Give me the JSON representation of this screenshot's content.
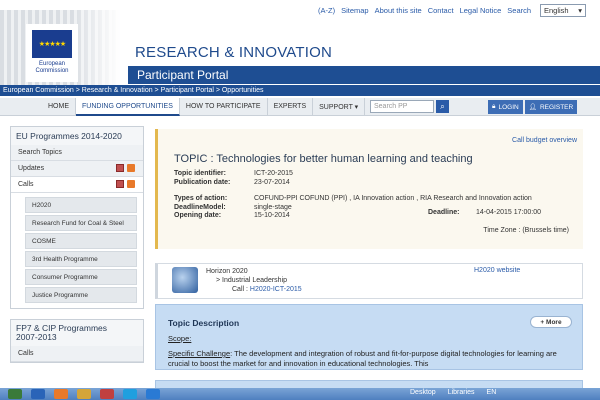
{
  "toplinks": [
    "(A-Z)",
    "Sitemap",
    "About this site",
    "Contact",
    "Legal Notice",
    "Search"
  ],
  "language": "English",
  "logo": {
    "line1": "European",
    "line2": "Commission"
  },
  "header": {
    "title": "RESEARCH & INNOVATION",
    "subtitle": "Participant Portal"
  },
  "breadcrumb": "European Commission > Research & Innovation > Participant Portal > Opportunities",
  "nav": {
    "home": "HOME",
    "funding": "FUNDING OPPORTUNITIES",
    "how": "HOW TO PARTICIPATE",
    "experts": "EXPERTS",
    "support": "SUPPORT ▾"
  },
  "search": {
    "placeholder": "Search PP"
  },
  "auth": {
    "login": "LOGIN",
    "register": "REGISTER"
  },
  "sidebar": {
    "section1": "EU Programmes 2014-2020",
    "search_topics": "Search Topics",
    "updates": "Updates",
    "calls": "Calls",
    "programmes": [
      "H2020",
      "Research Fund for Coal & Steel",
      "COSME",
      "3rd Health Programme",
      "Consumer Programme",
      "Justice Programme"
    ],
    "section2_line1": "FP7 & CIP Programmes",
    "section2_line2": "2007-2013",
    "calls2": "Calls"
  },
  "topic": {
    "budget_link": "Call budget overview",
    "title": "TOPIC : Technologies for better human learning and teaching",
    "identifier_label": "Topic identifier:",
    "identifier": "ICT-20-2015",
    "pubdate_label": "Publication date:",
    "pubdate": "23-07-2014",
    "actions_label": "Types of action:",
    "actions": "COFUND-PPI COFUND (PPI) , IA Innovation action , RIA Research and Innovation action",
    "model_label": "DeadlineModel:",
    "model": "single-stage",
    "opening_label": "Opening date:",
    "opening": "15-10-2014",
    "deadline_label": "Deadline:",
    "deadline": "14-04-2015 17:00:00",
    "timezone": "Time Zone : (Brussels time)"
  },
  "h2020": {
    "programme": "Horizon 2020",
    "pillar": "> Industrial Leadership",
    "call_label": "Call :",
    "call": "H2020-ICT-2015",
    "website": "H2020 website"
  },
  "description": {
    "title": "Topic Description",
    "more": "+ More",
    "scope": "Scope:",
    "challenge_label": "Specific Challenge",
    "challenge_text": ": The development and integration of robust and fit-for-purpose digital technologies for learning are crucial to boost the market for and innovation in educational technologies.  This"
  },
  "taskbar": {
    "desktop": "Desktop",
    "libraries": "Libraries",
    "lang": "EN"
  },
  "colors": {
    "brand_blue": "#1e4e93",
    "accent": "#e3b84e",
    "link": "#2a5ba8"
  }
}
